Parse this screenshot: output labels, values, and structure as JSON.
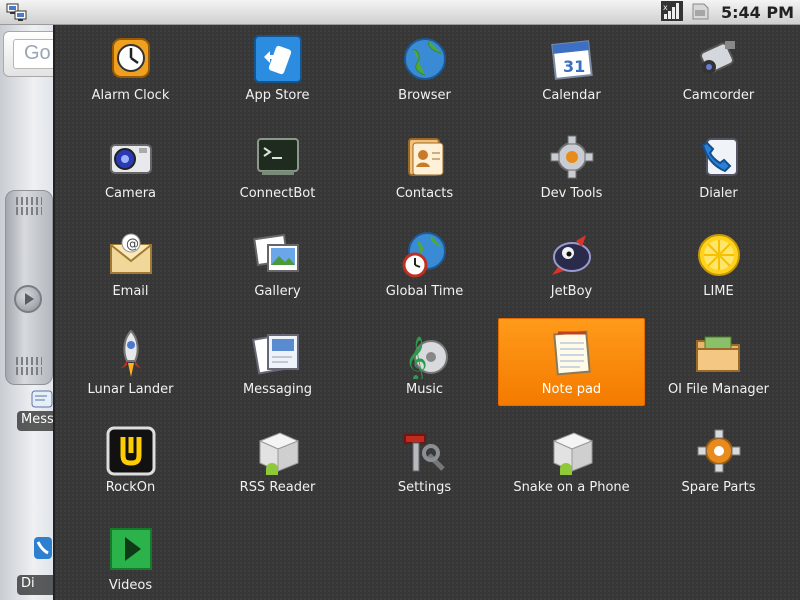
{
  "status_bar": {
    "time": "5:44 PM",
    "icons": [
      "network-activity-icon",
      "signal-strength-icon",
      "sd-card-icon"
    ]
  },
  "home": {
    "search_placeholder": "Go",
    "shortcuts": [
      {
        "label": "Mess",
        "icon": "messaging-icon"
      },
      {
        "label": "Di",
        "icon": "dialer-icon"
      }
    ]
  },
  "drawer": {
    "selected_app": "Note pad",
    "apps": [
      {
        "label": "Alarm Clock",
        "icon": "alarm-clock-icon"
      },
      {
        "label": "App Store",
        "icon": "app-store-icon"
      },
      {
        "label": "Browser",
        "icon": "globe-icon"
      },
      {
        "label": "Calendar",
        "icon": "calendar-icon"
      },
      {
        "label": "Camcorder",
        "icon": "camcorder-icon"
      },
      {
        "label": "Camera",
        "icon": "camera-icon"
      },
      {
        "label": "ConnectBot",
        "icon": "terminal-icon"
      },
      {
        "label": "Contacts",
        "icon": "contacts-icon"
      },
      {
        "label": "Dev Tools",
        "icon": "gear-icon"
      },
      {
        "label": "Dialer",
        "icon": "phone-icon"
      },
      {
        "label": "Email",
        "icon": "email-icon"
      },
      {
        "label": "Gallery",
        "icon": "gallery-icon"
      },
      {
        "label": "Global Time",
        "icon": "global-time-icon"
      },
      {
        "label": "JetBoy",
        "icon": "jetboy-icon"
      },
      {
        "label": "LIME",
        "icon": "lime-icon"
      },
      {
        "label": "Lunar Lander",
        "icon": "rocket-icon"
      },
      {
        "label": "Messaging",
        "icon": "messaging-icon"
      },
      {
        "label": "Music",
        "icon": "music-icon"
      },
      {
        "label": "Note pad",
        "icon": "notepad-icon"
      },
      {
        "label": "OI File Manager",
        "icon": "folder-icon"
      },
      {
        "label": "RockOn",
        "icon": "rockon-icon"
      },
      {
        "label": "RSS Reader",
        "icon": "android-box-icon"
      },
      {
        "label": "Settings",
        "icon": "settings-icon"
      },
      {
        "label": "Snake on a Phone",
        "icon": "android-box-icon"
      },
      {
        "label": "Spare Parts",
        "icon": "spare-parts-icon"
      },
      {
        "label": "Videos",
        "icon": "play-icon"
      }
    ]
  },
  "colors": {
    "drawer_bg": "#373737",
    "selection": "#f47b00",
    "status_bar": "#e0e0e0"
  }
}
